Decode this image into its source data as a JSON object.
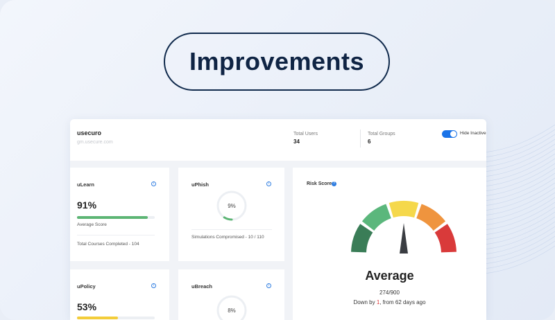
{
  "banner": {
    "title": "Improvements"
  },
  "header": {
    "org_name": "usecuro",
    "org_domain": "gm.usecure.com",
    "total_users_label": "Total Users",
    "total_users_value": "34",
    "total_groups_label": "Total Groups",
    "total_groups_value": "6",
    "hide_inactive_label": "Hide Inactive",
    "hide_inactive_on": true
  },
  "ulearn": {
    "title": "uLearn",
    "percent": "91%",
    "progress": 0.91,
    "bar_color": "#5cb574",
    "score_label": "Average Score",
    "footer": "Total Courses Completed - 104"
  },
  "uphish": {
    "title": "uPhish",
    "percent": "9%",
    "progress": 0.09,
    "footer": "Simulations Compromised - 10 / 110"
  },
  "upolicy": {
    "title": "uPolicy",
    "percent": "53%",
    "progress": 0.53,
    "bar_color": "#f3cd3a"
  },
  "ubreach": {
    "title": "uBreach",
    "percent": "8%",
    "progress": 0.08
  },
  "risk": {
    "title": "Risk Score",
    "level": "Average",
    "score": "274/900",
    "trend_prefix": "Down by ",
    "trend_value": "1",
    "trend_suffix": ", from 62 days ago",
    "gauge_colors": [
      "#3a7d57",
      "#5bb77c",
      "#f5d84b",
      "#ef943e",
      "#d93a3a"
    ]
  },
  "colors": {
    "accent": "#1a73e8",
    "ring_green": "#5cb574"
  }
}
